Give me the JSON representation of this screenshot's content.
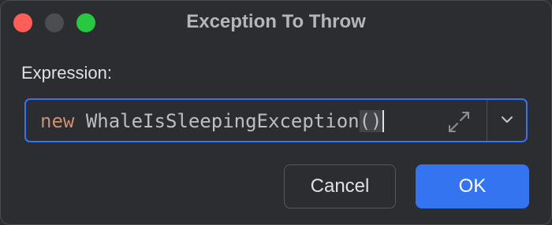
{
  "window": {
    "title": "Exception To Throw"
  },
  "expression": {
    "label": "Expression:",
    "keyword": "new",
    "class_name": "WhaleIsSleepingException",
    "parens": "()"
  },
  "icons": {
    "expand": "expand-diagonal-arrows-icon",
    "dropdown": "chevron-down-icon"
  },
  "buttons": {
    "cancel_label": "Cancel",
    "ok_label": "OK"
  },
  "colors": {
    "accent": "#3574f0",
    "keyword": "#cf8e6d",
    "close": "#ff5f57",
    "zoom": "#28c840"
  }
}
